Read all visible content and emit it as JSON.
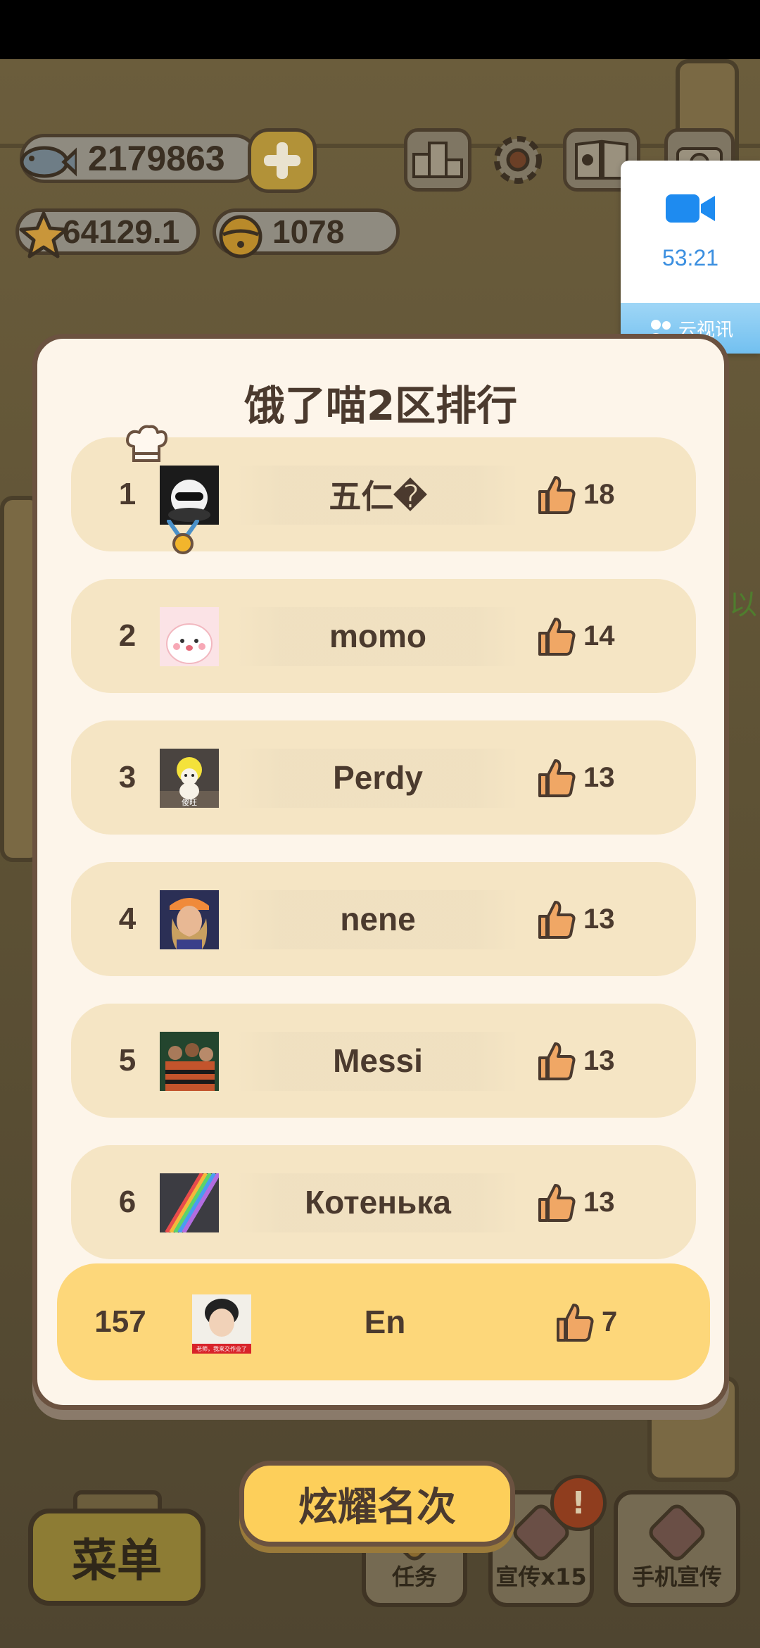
{
  "hud": {
    "fish": "2179863",
    "stars": "64129.1",
    "bells": "1078",
    "icons": [
      "ranking-icon",
      "gear-icon",
      "book-icon",
      "camera-icon"
    ]
  },
  "video_call": {
    "time": "53:21",
    "brand": "云视讯",
    "accent": "#3b8fe0"
  },
  "leaderboard": {
    "title": "饿了喵2区排行",
    "rows": [
      {
        "rank": "1",
        "name": "五仁�",
        "likes": "18"
      },
      {
        "rank": "2",
        "name": "momo",
        "likes": "14"
      },
      {
        "rank": "3",
        "name": "Perdy",
        "likes": "13"
      },
      {
        "rank": "4",
        "name": "nene",
        "likes": "13"
      },
      {
        "rank": "5",
        "name": "Messi",
        "likes": "13"
      },
      {
        "rank": "6",
        "name": "Котенька",
        "likes": "13"
      }
    ],
    "me": {
      "rank": "157",
      "name": "En",
      "likes": "7",
      "avatar_caption": "老师，我来交作业了"
    }
  },
  "avatars": {
    "perdy_caption": "傻旺"
  },
  "bottom": {
    "show_rank": "炫耀名次",
    "menu": "菜单",
    "task": "任务",
    "promote": "宣传x15",
    "phone_promote": "手机宣传",
    "side_peek": "以"
  }
}
